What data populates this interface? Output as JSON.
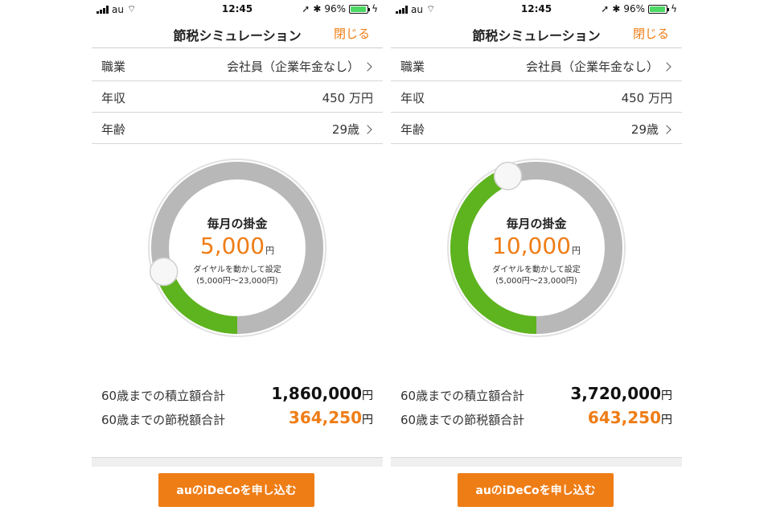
{
  "colors": {
    "accent": "#ef7d16",
    "green": "#5eb41e",
    "track": "#b8b8b8"
  },
  "screens": [
    {
      "status": {
        "carrier": "au",
        "time": "12:45",
        "battery": "96%",
        "battery_level": 0.96
      },
      "nav": {
        "title": "節税シミュレーション",
        "close_label": "閉じる"
      },
      "rows": [
        {
          "label": "職業",
          "value": "会社員（企業年金なし）"
        },
        {
          "label": "年収",
          "value": "450 万円"
        },
        {
          "label": "年齢",
          "value": "29歳"
        }
      ],
      "dial": {
        "title": "毎月の掛金",
        "amount": "5,000",
        "unit": "円",
        "hint1": "ダイヤルを動かして設定",
        "hint2": "(5,000円〜23,000円)",
        "fill_fraction": 0.2
      },
      "sums": [
        {
          "label": "60歳までの積立額合計",
          "value": "1,860,000",
          "unit": "円"
        },
        {
          "label": "60歳までの節税額合計",
          "value": "364,250",
          "unit": "円"
        }
      ],
      "button_label": "auのiDeCoを申し込む"
    },
    {
      "status": {
        "carrier": "au",
        "time": "12:45",
        "battery": "96%",
        "battery_level": 0.96
      },
      "nav": {
        "title": "節税シミュレーション",
        "close_label": "閉じる"
      },
      "rows": [
        {
          "label": "職業",
          "value": "会社員（企業年金なし）"
        },
        {
          "label": "年収",
          "value": "450 万円"
        },
        {
          "label": "年齢",
          "value": "29歳"
        }
      ],
      "dial": {
        "title": "毎月の掛金",
        "amount": "10,000",
        "unit": "円",
        "hint1": "ダイヤルを動かして設定",
        "hint2": "(5,000円〜23,000円)",
        "fill_fraction": 0.44
      },
      "sums": [
        {
          "label": "60歳までの積立額合計",
          "value": "3,720,000",
          "unit": "円"
        },
        {
          "label": "60歳までの節税額合計",
          "value": "643,250",
          "unit": "円"
        }
      ],
      "button_label": "auのiDeCoを申し込む"
    }
  ]
}
